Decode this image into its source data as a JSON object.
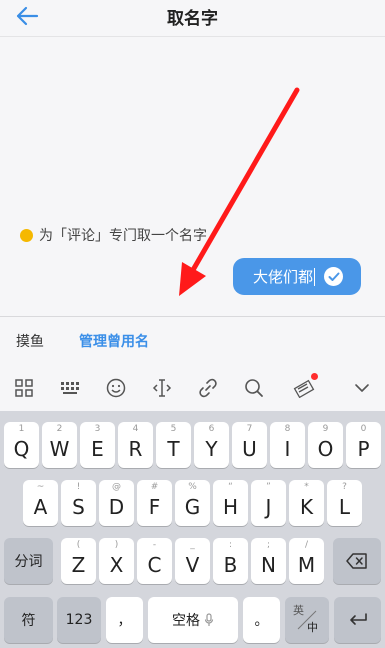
{
  "header": {
    "title": "取名字",
    "back_icon": "arrow-left-icon"
  },
  "hint": {
    "text": "为「评论」专门取一个名字"
  },
  "name_input": {
    "value": "大佬们都",
    "confirm_icon": "checkmark-icon"
  },
  "tabs": [
    {
      "label": "摸鱼"
    },
    {
      "label": "管理曾用名"
    }
  ],
  "toolbar": {
    "icons": [
      "grid-icon",
      "keyboard-icon",
      "emoji-icon",
      "text-cursor-icon",
      "link-icon",
      "search-icon",
      "handwriting-icon",
      "chevron-down-icon"
    ]
  },
  "keyboard": {
    "row1": [
      {
        "sub": "1",
        "main": "Q"
      },
      {
        "sub": "2",
        "main": "W"
      },
      {
        "sub": "3",
        "main": "E"
      },
      {
        "sub": "4",
        "main": "R"
      },
      {
        "sub": "5",
        "main": "T"
      },
      {
        "sub": "6",
        "main": "Y"
      },
      {
        "sub": "7",
        "main": "U"
      },
      {
        "sub": "8",
        "main": "I"
      },
      {
        "sub": "9",
        "main": "O"
      },
      {
        "sub": "0",
        "main": "P"
      }
    ],
    "row2": [
      {
        "sub": "~",
        "main": "A"
      },
      {
        "sub": "!",
        "main": "S"
      },
      {
        "sub": "@",
        "main": "D"
      },
      {
        "sub": "#",
        "main": "F"
      },
      {
        "sub": "%",
        "main": "G"
      },
      {
        "sub": "“",
        "main": "H"
      },
      {
        "sub": "”",
        "main": "J"
      },
      {
        "sub": "*",
        "main": "K"
      },
      {
        "sub": "?",
        "main": "L"
      }
    ],
    "row3": [
      {
        "sub": "(",
        "main": "Z"
      },
      {
        "sub": ")",
        "main": "X"
      },
      {
        "sub": "-",
        "main": "C"
      },
      {
        "sub": "_",
        "main": "V"
      },
      {
        "sub": ":",
        "main": "B"
      },
      {
        "sub": ";",
        "main": "N"
      },
      {
        "sub": "/",
        "main": "M"
      }
    ],
    "fenci": "分词",
    "symbols": "符",
    "numbers": "123",
    "comma": "，",
    "space": "空格",
    "period": "。",
    "lang_top": "英",
    "lang_bottom": "中"
  },
  "colors": {
    "accent": "#4a97e8",
    "arrow": "#ff1a1a",
    "notice": "#f5b800"
  }
}
